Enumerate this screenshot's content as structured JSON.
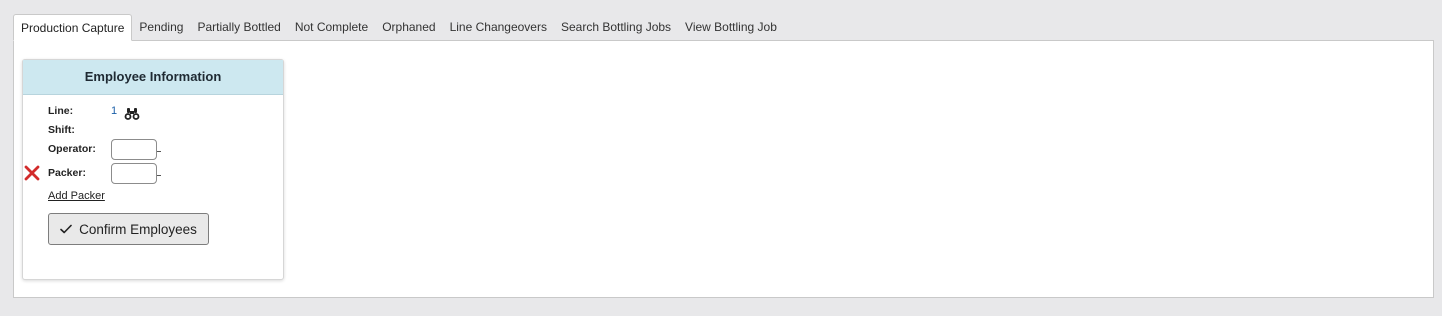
{
  "tabs": [
    {
      "label": "Production Capture",
      "active": true
    },
    {
      "label": "Pending"
    },
    {
      "label": "Partially Bottled"
    },
    {
      "label": "Not Complete"
    },
    {
      "label": "Orphaned"
    },
    {
      "label": "Line Changeovers"
    },
    {
      "label": "Search Bottling Jobs"
    },
    {
      "label": "View Bottling Job"
    }
  ],
  "employee_card": {
    "title": "Employee Information",
    "line_label": "Line:",
    "line_value": "1",
    "shift_label": "Shift:",
    "operator_label": "Operator:",
    "operator_value": "",
    "packer_label": "Packer:",
    "packer_value": "",
    "add_packer_label": "Add Packer",
    "confirm_label": "Confirm Employees"
  },
  "icons": {
    "line_lookup": "binoculars-icon",
    "remove_packer": "red-x-icon",
    "confirm": "check-icon"
  },
  "colors": {
    "card_header_bg": "#cde8f0",
    "link_blue": "#1a5fa8",
    "remove_red": "#d22b2b"
  }
}
